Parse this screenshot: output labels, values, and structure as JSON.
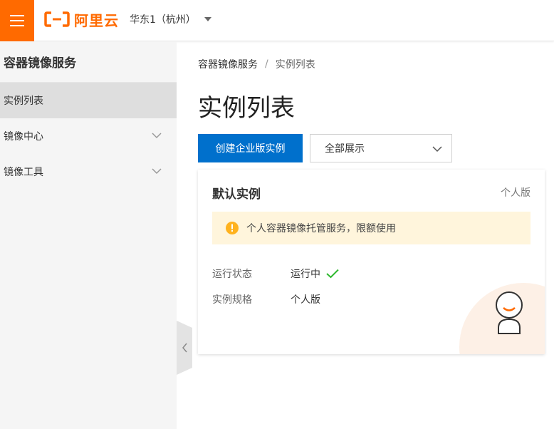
{
  "header": {
    "logo_text": "阿里云",
    "region": "华东1（杭州）",
    "brand_color": "#ff6a00"
  },
  "sidebar": {
    "title": "容器镜像服务",
    "items": [
      {
        "label": "实例列表",
        "active": true
      },
      {
        "label": "镜像中心",
        "expandable": true
      },
      {
        "label": "镜像工具",
        "expandable": true
      }
    ]
  },
  "breadcrumb": {
    "root": "容器镜像服务",
    "separator": "/",
    "current": "实例列表"
  },
  "page": {
    "title": "实例列表",
    "create_button": "创建企业版实例",
    "filter_select": "全部展示",
    "primary_color": "#0070cc"
  },
  "card": {
    "title": "默认实例",
    "tag": "个人版",
    "notice": "个人容器镜像托管服务，限额使用",
    "status_label": "运行状态",
    "status_value": "运行中",
    "spec_label": "实例规格",
    "spec_value": "个人版",
    "notice_color": "#fff5dc",
    "ok_color": "#2eb82e"
  }
}
